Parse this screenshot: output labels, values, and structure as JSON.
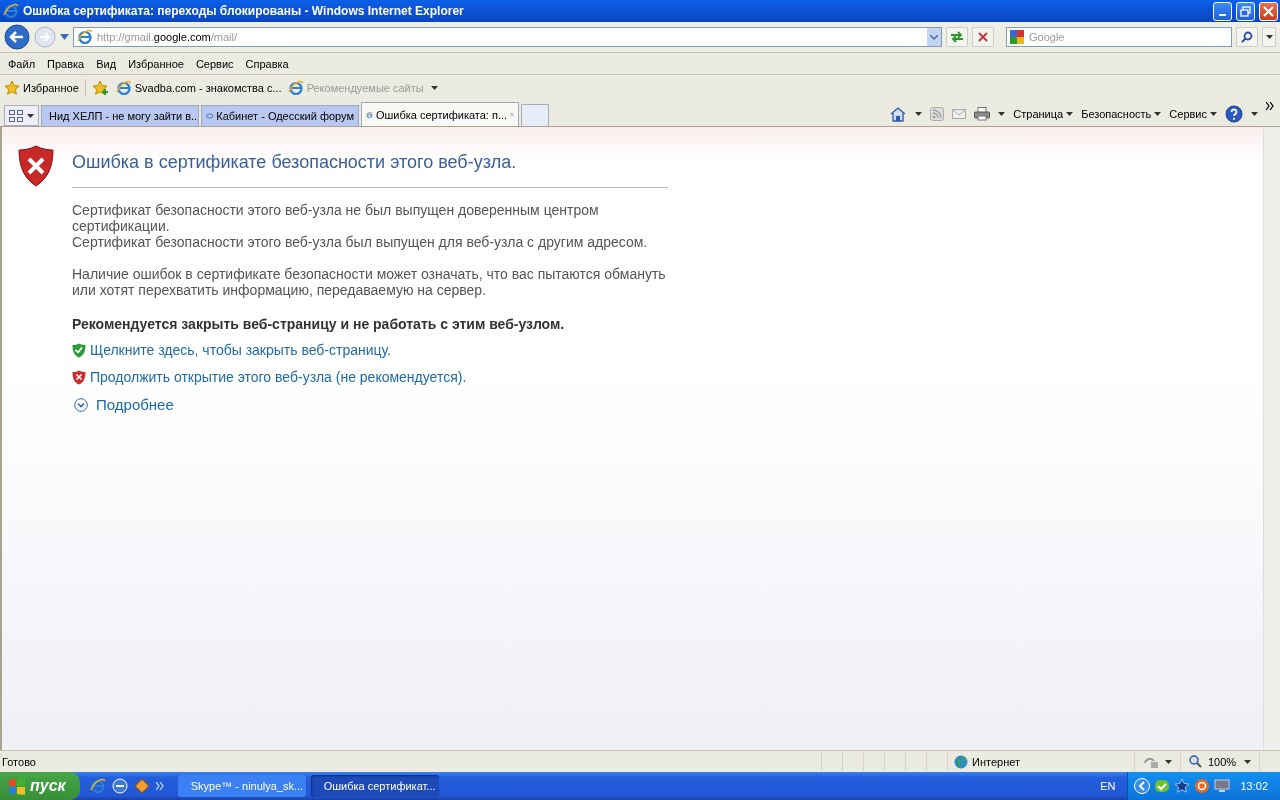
{
  "window": {
    "title": "Ошибка сертификата: переходы блокированы - Windows Internet Explorer"
  },
  "address_bar": {
    "url_prefix": "http://gmail.",
    "url_domain": "google.com",
    "url_path": "/mail/"
  },
  "search": {
    "placeholder": "Google"
  },
  "menu": [
    "Файл",
    "Правка",
    "Вид",
    "Избранное",
    "Сервис",
    "Справка"
  ],
  "favorites_bar": {
    "favorites_label": "Избранное",
    "links": [
      {
        "label": "Svadba.com - знакомства с...",
        "disabled": false,
        "has_menu": false
      },
      {
        "label": "Рекомендуемые сайты",
        "disabled": true,
        "has_menu": true
      }
    ]
  },
  "tabs": [
    {
      "label": "Нид ХЕЛП - не могу зайти в...",
      "selected": false
    },
    {
      "label": "Кабинет - Одесский форум",
      "selected": false
    },
    {
      "label": "Ошибка сертификата: п...",
      "selected": true
    }
  ],
  "command_bar": [
    "Страница",
    "Безопасность",
    "Сервис"
  ],
  "page": {
    "heading": "Ошибка в сертификате безопасности этого веб-узла.",
    "issues": [
      "Сертификат безопасности этого веб-узла не был выпущен доверенным центром сертификации.",
      "Сертификат безопасности этого веб-узла был выпущен для веб-узла с другим адресом."
    ],
    "warning": "Наличие ошибок в сертификате безопасности может означать, что вас пытаются обмануть или хотят перехватить информацию, передаваемую на сервер.",
    "recommendation": "Рекомендуется закрыть веб-страницу и не работать с этим веб-узлом.",
    "actions": [
      {
        "kind": "safe",
        "label": "Щелкните здесь, чтобы закрыть веб-страницу."
      },
      {
        "kind": "unsafe",
        "label": "Продолжить открытие этого веб-узла (не рекомендуется)."
      }
    ],
    "more": "Подробнее"
  },
  "status_bar": {
    "text": "Готово",
    "zone": "Интернет",
    "zoom": "100%"
  },
  "taskbar": {
    "start": "пуск",
    "tasks": [
      {
        "label": "Skype™ - ninulya_sk...",
        "selected": false
      },
      {
        "label": "Ошибка сертификат...",
        "selected": true
      }
    ],
    "language": "EN",
    "clock": "13:02"
  }
}
